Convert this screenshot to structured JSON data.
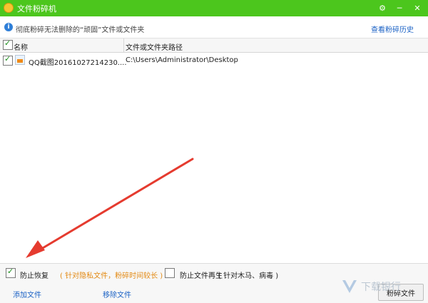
{
  "window": {
    "title": "文件粉碎机",
    "controls": [
      "⚙",
      "─",
      "✕"
    ]
  },
  "info": {
    "text": "彻底粉碎无法删除的“顽固”文件或文件夹",
    "history_link": "查看粉碎历史"
  },
  "table": {
    "columns": [
      "名称",
      "文件或文件夹路径"
    ],
    "rows": [
      {
        "checked": true,
        "name": "QQ截图20161027214230....",
        "path": "C:\\Users\\Administrator\\Desktop"
      }
    ]
  },
  "options": {
    "option1_label": "防止恢复",
    "option1_note": "( 针对隐私文件，粉碎时间较长 )",
    "option2_label": "防止文件再生",
    "option2_note": "( 针对木马、病毒 )"
  },
  "actions": {
    "add_files": "添加文件",
    "remove_files": "移除文件",
    "shred_button": "粉碎文件"
  },
  "watermark": {
    "text": "下载银行"
  },
  "colors": {
    "titlebar": "#4cc61d",
    "link": "#1b62c5",
    "note": "#e38a14",
    "arrow": "#e53b2f"
  }
}
